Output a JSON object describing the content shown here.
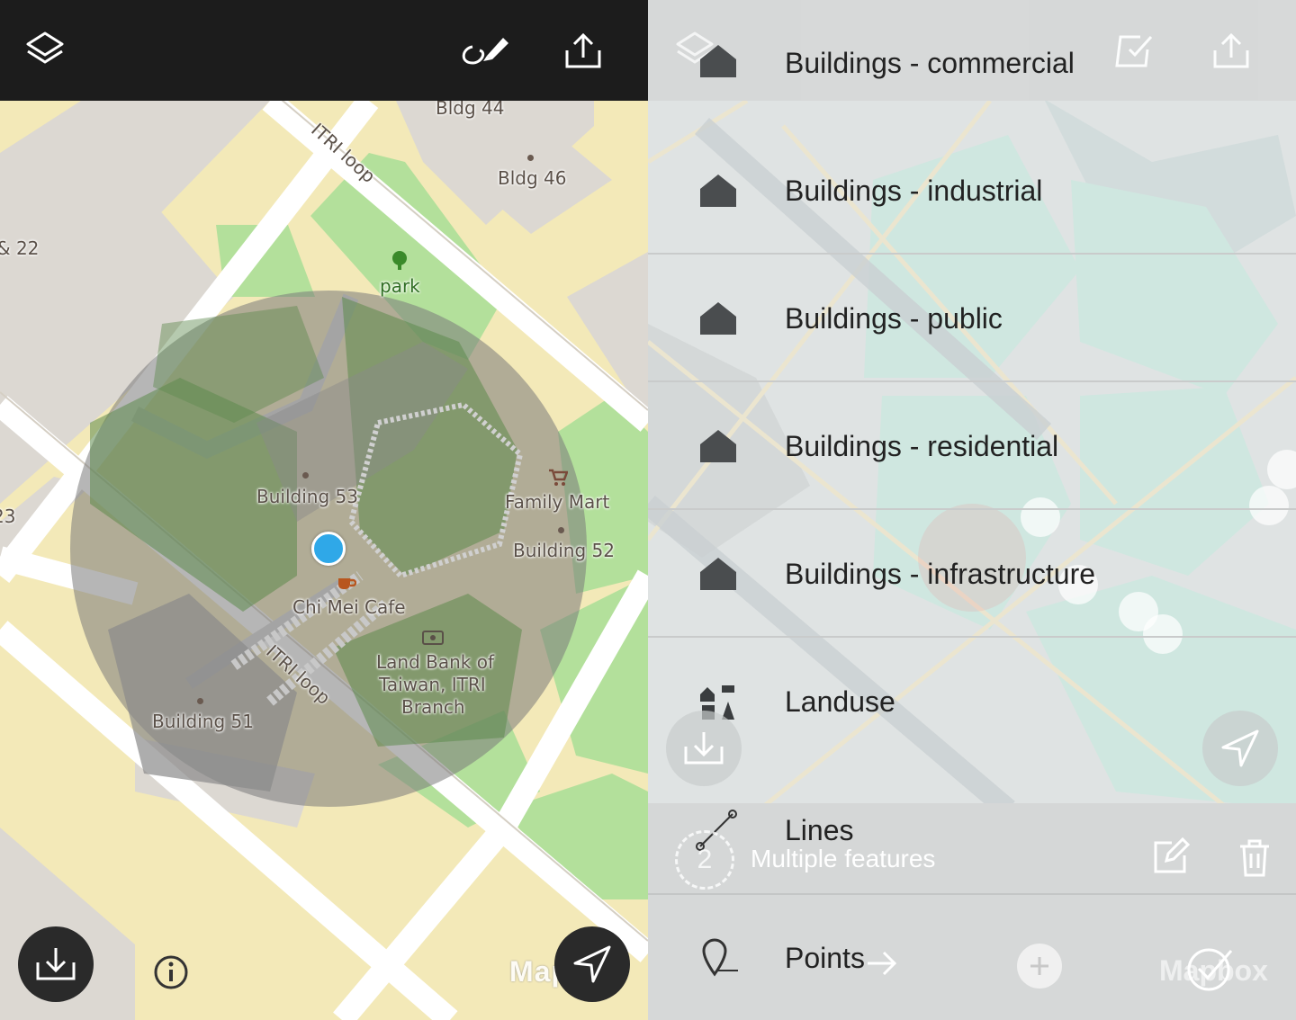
{
  "left": {
    "toolbar": {
      "layers_icon": "layers-icon",
      "draw_icon": "draw-pen-icon",
      "share_icon": "share-upload-icon"
    },
    "map_labels": {
      "bldg44": "Bldg 44",
      "bldg46": "Bldg 46",
      "road_top": "ITRI loop",
      "road_bottom": "ITRI loop",
      "edge_22": "& 22",
      "edge_23": "23",
      "park": "park",
      "building53": "Building 53",
      "family_mart": "Family Mart",
      "building52": "Building 52",
      "chi_mei": "Chi Mei Cafe",
      "land_bank_1": "Land Bank of",
      "land_bank_2": "Taiwan, ITRI",
      "land_bank_3": "Branch",
      "building51": "Building 51"
    },
    "attribution": "Mapbox",
    "buttons": {
      "download_icon": "download-icon",
      "info_icon": "info-icon",
      "locate_icon": "navigation-arrow-icon"
    },
    "colors": {
      "topbar": "#1c1c1c",
      "location_dot": "#2fa8e8",
      "park": "#b3e09b",
      "road_fill": "#f3e9b8"
    }
  },
  "right": {
    "toolbar": {
      "layers_icon": "layers-icon",
      "select_icon": "checkbox-select-icon",
      "share_icon": "share-upload-icon"
    },
    "layers": [
      {
        "label": "Buildings - commercial",
        "icon": "house-icon"
      },
      {
        "label": "Buildings - industrial",
        "icon": "house-icon"
      },
      {
        "label": "Buildings - public",
        "icon": "house-icon"
      },
      {
        "label": "Buildings - residential",
        "icon": "house-icon"
      },
      {
        "label": "Buildings - infrastructure",
        "icon": "house-icon"
      },
      {
        "label": "Landuse",
        "icon": "landuse-icon"
      }
    ],
    "lines": {
      "label": "Lines",
      "sublabel": "Multiple features",
      "badge": "2"
    },
    "points": {
      "label": "Points"
    },
    "attribution": "Mapbox"
  }
}
